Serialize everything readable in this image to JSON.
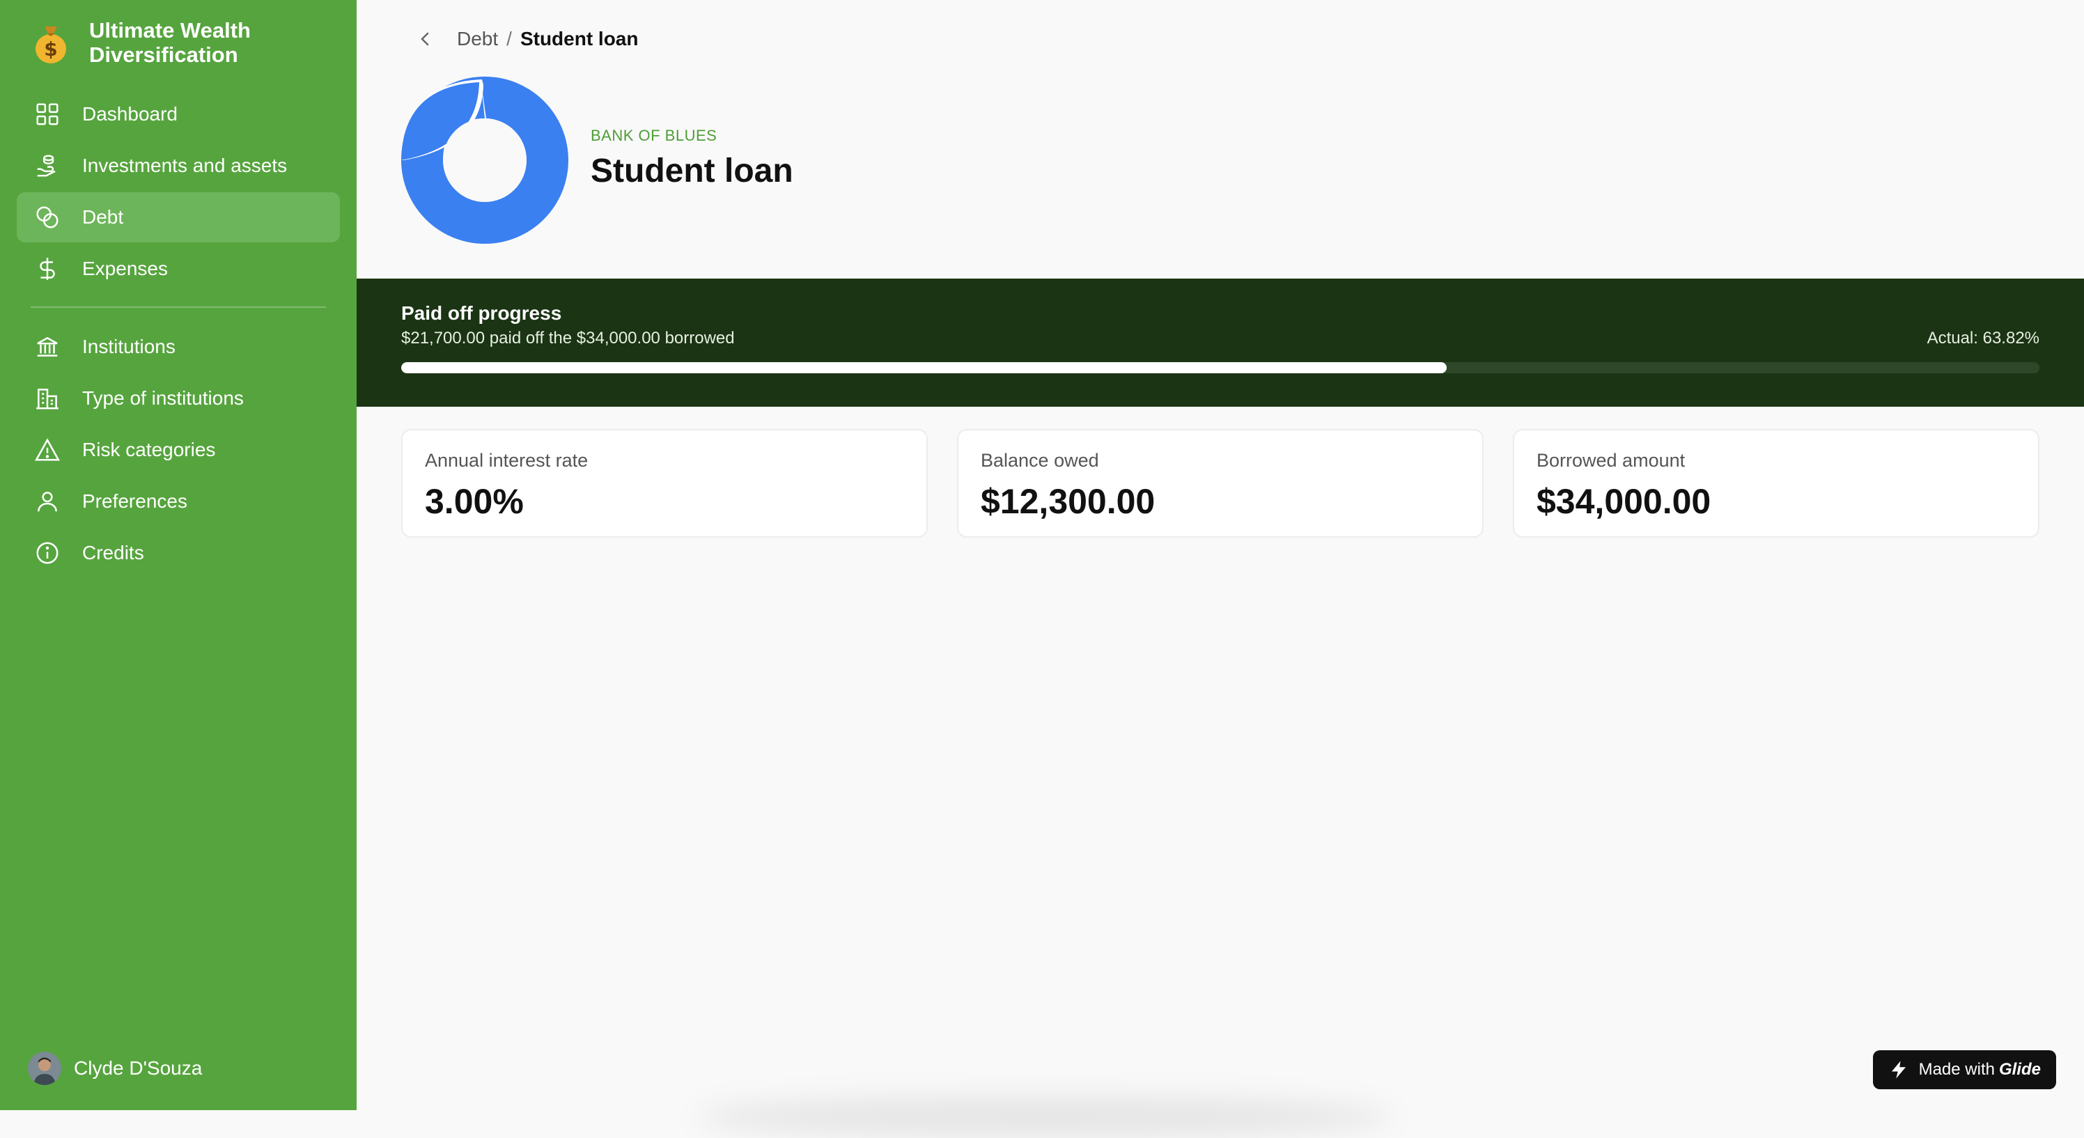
{
  "app": {
    "title": "Ultimate Wealth Diversification"
  },
  "sidebar": {
    "items": [
      {
        "label": "Dashboard",
        "icon": "grid-icon"
      },
      {
        "label": "Investments and assets",
        "icon": "hand-coins-icon"
      },
      {
        "label": "Debt",
        "icon": "coins-icon",
        "active": true
      },
      {
        "label": "Expenses",
        "icon": "dollar-icon"
      },
      {
        "label": "Institutions",
        "icon": "bank-icon"
      },
      {
        "label": "Type of institutions",
        "icon": "building-icon"
      },
      {
        "label": "Risk categories",
        "icon": "warning-icon"
      },
      {
        "label": "Preferences",
        "icon": "user-icon"
      },
      {
        "label": "Credits",
        "icon": "info-icon"
      }
    ],
    "user": {
      "name": "Clyde D'Souza"
    }
  },
  "breadcrumb": {
    "parent": "Debt",
    "separator": "/",
    "current": "Student loan"
  },
  "header": {
    "org": "BANK OF BLUES",
    "title": "Student loan"
  },
  "progress": {
    "title": "Paid off progress",
    "subtitle": "$21,700.00 paid off the $34,000.00 borrowed",
    "actual": "Actual: 63.82%",
    "fraction": 0.6382
  },
  "cards": [
    {
      "label": "Annual interest rate",
      "value": "3.00%"
    },
    {
      "label": "Balance owed",
      "value": "$12,300.00"
    },
    {
      "label": "Borrowed amount",
      "value": "$34,000.00"
    }
  ],
  "badge": {
    "prefix": "Made with",
    "brand": "Glide"
  },
  "colors": {
    "sidebar": "#56a43e",
    "band": "#1b3414",
    "accent_blue": "#3a80f0",
    "org_green": "#4e9d37"
  }
}
